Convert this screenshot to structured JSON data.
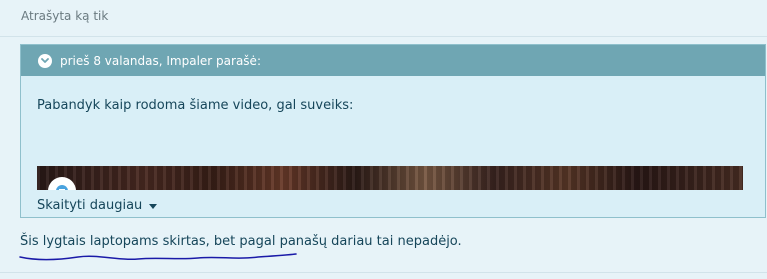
{
  "post": {
    "meta_text": "Atrašyta ką tik"
  },
  "quote": {
    "header_text": "prieš 8 valandas, Impaler parašė:",
    "body_text": "Pabandyk kaip rodoma šiame video, gal suveiks:",
    "read_more_label": "Skaityti daugiau",
    "expand_icon": "chevron-down-circle-icon",
    "video_avatar_icon": "youtube-channel-avatar-icon"
  },
  "reply": {
    "text": "Šis lygtais laptopams skirtas, bet pagal panašų dariau tai nepadėjo.",
    "annotation_color": "#1a1aa8"
  },
  "colors": {
    "quote_header_bg": "#6fa6b3",
    "quote_body_bg": "#d9eff7",
    "page_bg": "#e7f3f8",
    "text": "#16465a"
  }
}
